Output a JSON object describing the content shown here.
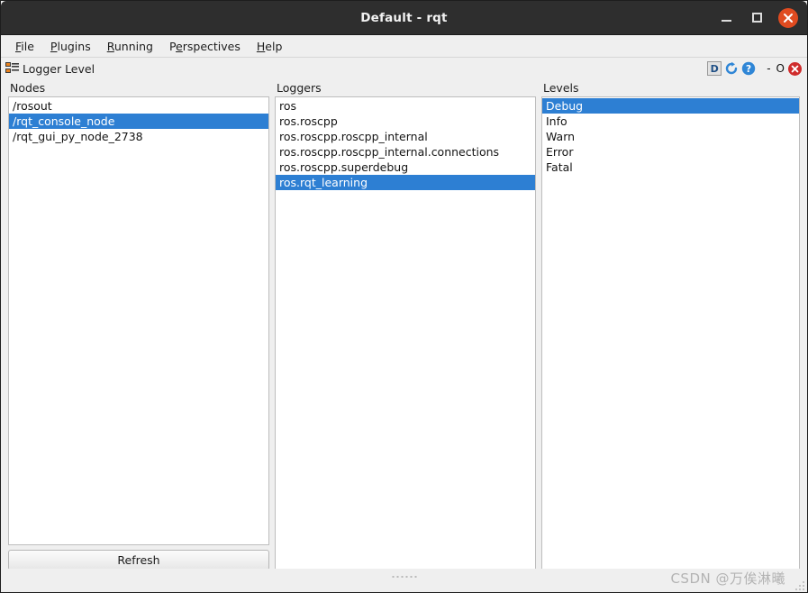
{
  "window": {
    "title": "Default - rqt",
    "controls": {
      "minimize": "minimize",
      "maximize": "maximize",
      "close": "close"
    }
  },
  "menubar": {
    "items": [
      {
        "pre": "",
        "mn": "F",
        "post": "ile"
      },
      {
        "pre": "",
        "mn": "P",
        "post": "lugins"
      },
      {
        "pre": "",
        "mn": "R",
        "post": "unning"
      },
      {
        "pre": "P",
        "mn": "e",
        "post": "rspectives"
      },
      {
        "pre": "",
        "mn": "H",
        "post": "elp"
      }
    ]
  },
  "dock": {
    "title": "Logger Level",
    "icon": "logger-level-icon",
    "toolbar": {
      "dock_label": "D",
      "reload_icon": "reload-icon",
      "help_icon": "help-icon",
      "float_label": "-",
      "undock_label": "O",
      "close_label": "x"
    }
  },
  "panels": {
    "nodes": {
      "header": "Nodes",
      "items": [
        {
          "label": "/rosout",
          "selected": false
        },
        {
          "label": "/rqt_console_node",
          "selected": true
        },
        {
          "label": "/rqt_gui_py_node_2738",
          "selected": false
        }
      ],
      "refresh_label": "Refresh"
    },
    "loggers": {
      "header": "Loggers",
      "items": [
        {
          "label": "ros",
          "selected": false
        },
        {
          "label": "ros.roscpp",
          "selected": false
        },
        {
          "label": "ros.roscpp.roscpp_internal",
          "selected": false
        },
        {
          "label": "ros.roscpp.roscpp_internal.connections",
          "selected": false
        },
        {
          "label": "ros.roscpp.superdebug",
          "selected": false
        },
        {
          "label": "ros.rqt_learning",
          "selected": true
        }
      ]
    },
    "levels": {
      "header": "Levels",
      "items": [
        {
          "label": "Debug",
          "selected": true
        },
        {
          "label": "Info",
          "selected": false
        },
        {
          "label": "Warn",
          "selected": false
        },
        {
          "label": "Error",
          "selected": false
        },
        {
          "label": "Fatal",
          "selected": false
        }
      ]
    }
  },
  "footer": {
    "watermark": "CSDN @万俟淋曦"
  },
  "colors": {
    "selection": "#2d7fd3",
    "titlebar": "#2e2e2e",
    "close_button": "#e04b20",
    "dock_close": "#cf2b2b",
    "window_bg": "#efefef"
  }
}
